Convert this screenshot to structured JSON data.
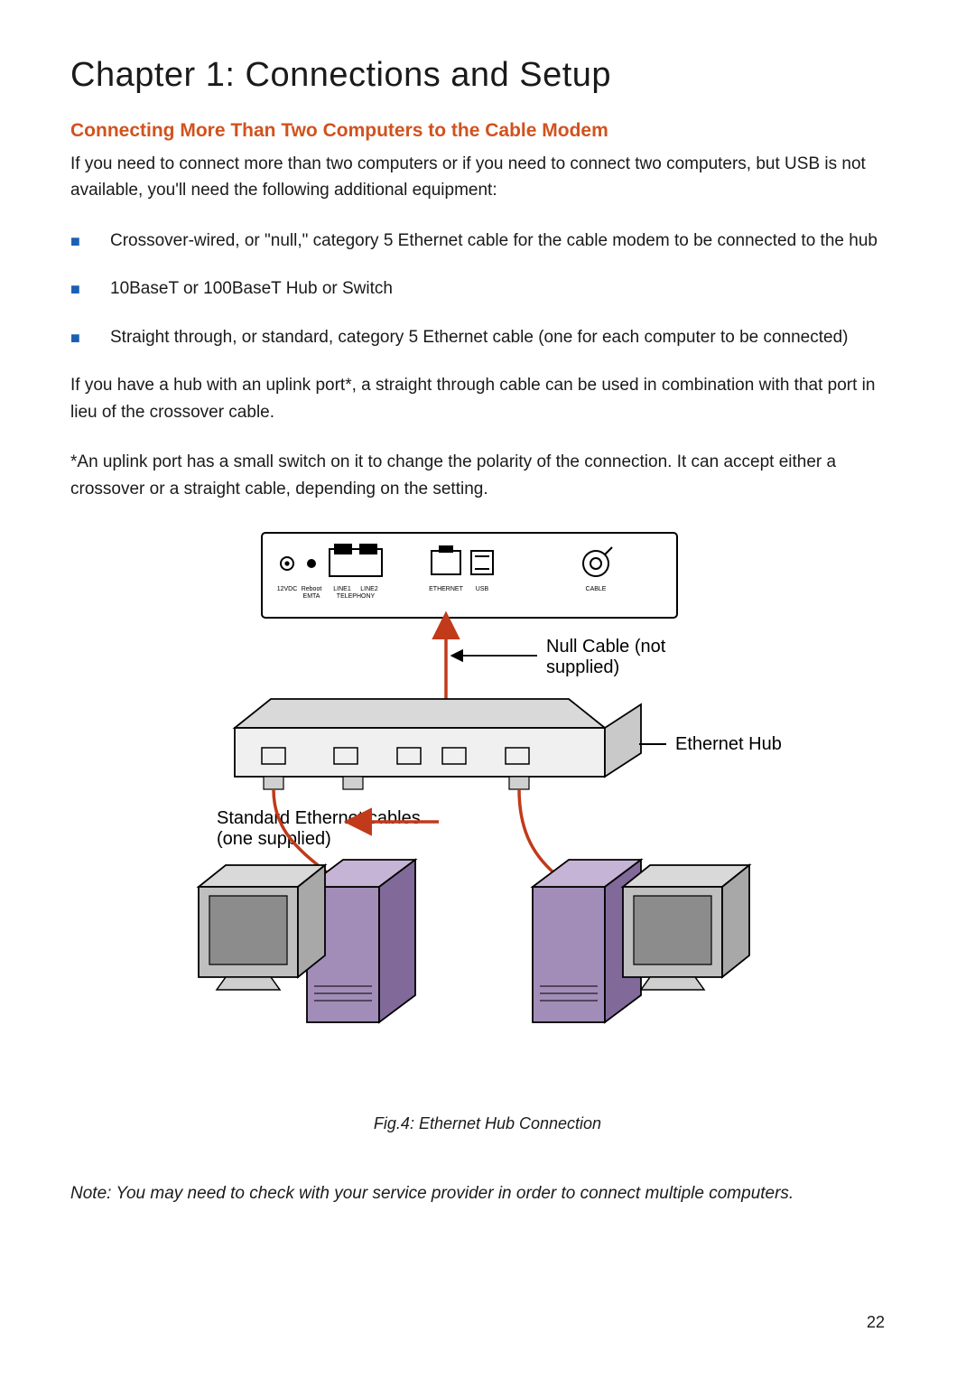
{
  "chapter": {
    "title": "Chapter 1: Connections and Setup"
  },
  "section": {
    "title": "Connecting More Than Two Computers to the Cable Modem"
  },
  "paragraphs": {
    "intro": "If you need to connect more than two computers or if you need to connect two computers, but USB is not available, you'll need the following additional equipment:",
    "uplink": "If you have a hub with an uplink port*, a straight through cable can be used in combination with that port in lieu of the crossover cable.",
    "footnote": "*An uplink port has a small switch on it to change the polarity of the connection. It can accept either a crossover or a straight cable, depending on the setting."
  },
  "bullets": [
    "Crossover-wired, or \"null,\" category 5 Ethernet cable for the cable modem to be connected to the hub",
    "10BaseT or 100BaseT Hub or Switch",
    "Straight through, or standard, category 5 Ethernet cable (one for each computer to be connected)"
  ],
  "figure": {
    "caption": "Fig.4: Ethernet Hub Connection",
    "labels": {
      "null_cable_line1": "Null Cable (not",
      "null_cable_line2": "supplied)",
      "ethernet_hub": "Ethernet Hub",
      "std_cable_line1": "Standard Ethernet cables",
      "std_cable_line2": "(one supplied)"
    },
    "port_labels": {
      "p1a": "12VDC",
      "p2a": "Reboot",
      "p2b": "EMTA",
      "p3a": "LINE1",
      "p4a": "LINE2",
      "p34b": "TELEPHONY",
      "p5a": "ETHERNET",
      "p6a": "USB",
      "p7a": "CABLE"
    }
  },
  "note": "Note: You may need to check with your service provider in order to connect multiple computers.",
  "page_number": "22"
}
